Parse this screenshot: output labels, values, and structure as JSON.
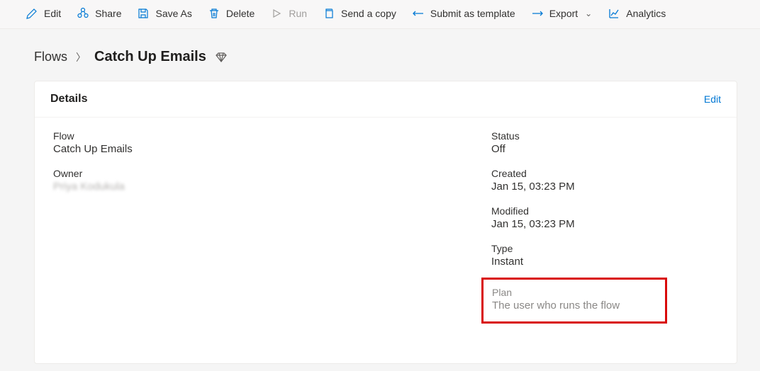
{
  "commands": {
    "edit": "Edit",
    "share": "Share",
    "saveAs": "Save As",
    "delete": "Delete",
    "run": "Run",
    "sendCopy": "Send a copy",
    "submitTemplate": "Submit as template",
    "export": "Export",
    "analytics": "Analytics"
  },
  "breadcrumb": {
    "parent": "Flows",
    "current": "Catch Up Emails"
  },
  "panel": {
    "title": "Details",
    "editLink": "Edit"
  },
  "details": {
    "flow": {
      "label": "Flow",
      "value": "Catch Up Emails"
    },
    "owner": {
      "label": "Owner",
      "value": "Priya Kodukula"
    },
    "status": {
      "label": "Status",
      "value": "Off"
    },
    "created": {
      "label": "Created",
      "value": "Jan 15, 03:23 PM"
    },
    "modified": {
      "label": "Modified",
      "value": "Jan 15, 03:23 PM"
    },
    "type": {
      "label": "Type",
      "value": "Instant"
    },
    "plan": {
      "label": "Plan",
      "value": "The user who runs the flow"
    }
  }
}
